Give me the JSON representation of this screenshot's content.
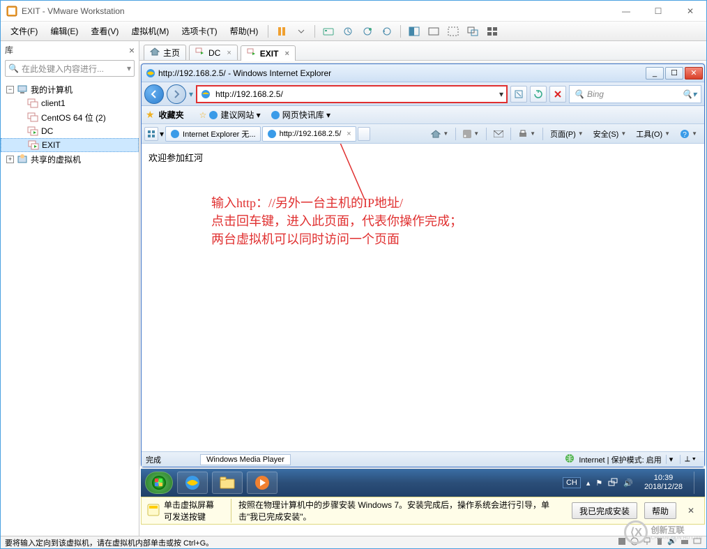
{
  "titlebar": {
    "app_icon": "vmware",
    "title": "EXIT - VMware Workstation"
  },
  "menubar": {
    "items": [
      "文件(F)",
      "编辑(E)",
      "查看(V)",
      "虚拟机(M)",
      "选项卡(T)",
      "帮助(H)"
    ]
  },
  "sidebar": {
    "title": "库",
    "search_placeholder": "在此处键入内容进行...",
    "tree": [
      {
        "label": "我的计算机",
        "expanded": true,
        "icon": "computer",
        "children": [
          {
            "label": "client1",
            "icon": "vm"
          },
          {
            "label": "CentOS 64 位 (2)",
            "icon": "vm"
          },
          {
            "label": "DC",
            "icon": "vm-on"
          },
          {
            "label": "EXIT",
            "icon": "vm-on",
            "selected": true
          }
        ]
      },
      {
        "label": "共享的虚拟机",
        "expanded": false,
        "icon": "shared"
      }
    ]
  },
  "tabs": [
    {
      "label": "主页",
      "icon": "home"
    },
    {
      "label": "DC",
      "icon": "vm-on",
      "closable": true
    },
    {
      "label": "EXIT",
      "icon": "vm-on",
      "closable": true,
      "active": true
    }
  ],
  "ie": {
    "title": "http://192.168.2.5/ - Windows Internet Explorer",
    "address": "http://192.168.2.5/",
    "search_placeholder": "Bing",
    "favorites_label": "收藏夹",
    "fav_items": [
      "建议网站 ▾",
      "网页快讯库 ▾"
    ],
    "page_tabs": [
      {
        "label": "Internet Explorer 无..."
      },
      {
        "label": "http://192.168.2.5/",
        "active": true
      }
    ],
    "tools": [
      "页面(P)",
      "安全(S)",
      "工具(O)"
    ],
    "page_text": "欢迎参加红河",
    "annotation": [
      "输入http：//另外一台主机的IP地址/",
      "点击回车键，进入此页面，代表你操作完成；",
      "两台虚拟机可以同时访问一个页面"
    ],
    "status_left": "完成",
    "status_mid": "Windows Media Player",
    "status_right": "Internet | 保护模式: 启用",
    "zone_icon": "globe"
  },
  "win7": {
    "lang": "CH",
    "time": "10:39",
    "date": "2018/12/28"
  },
  "hint": {
    "left1": "单击虚拟屏幕",
    "left2": "可发送按键",
    "mid": "按照在物理计算机中的步骤安装 Windows 7。安装完成后，操作系统会进行引导，单击\"我已完成安装\"。",
    "btn1": "我已完成安装",
    "btn2": "帮助"
  },
  "statusbar": {
    "text": "要将输入定向到该虚拟机，请在虚拟机内部单击或按 Ctrl+G。"
  },
  "watermark": {
    "text": "创新互联"
  }
}
